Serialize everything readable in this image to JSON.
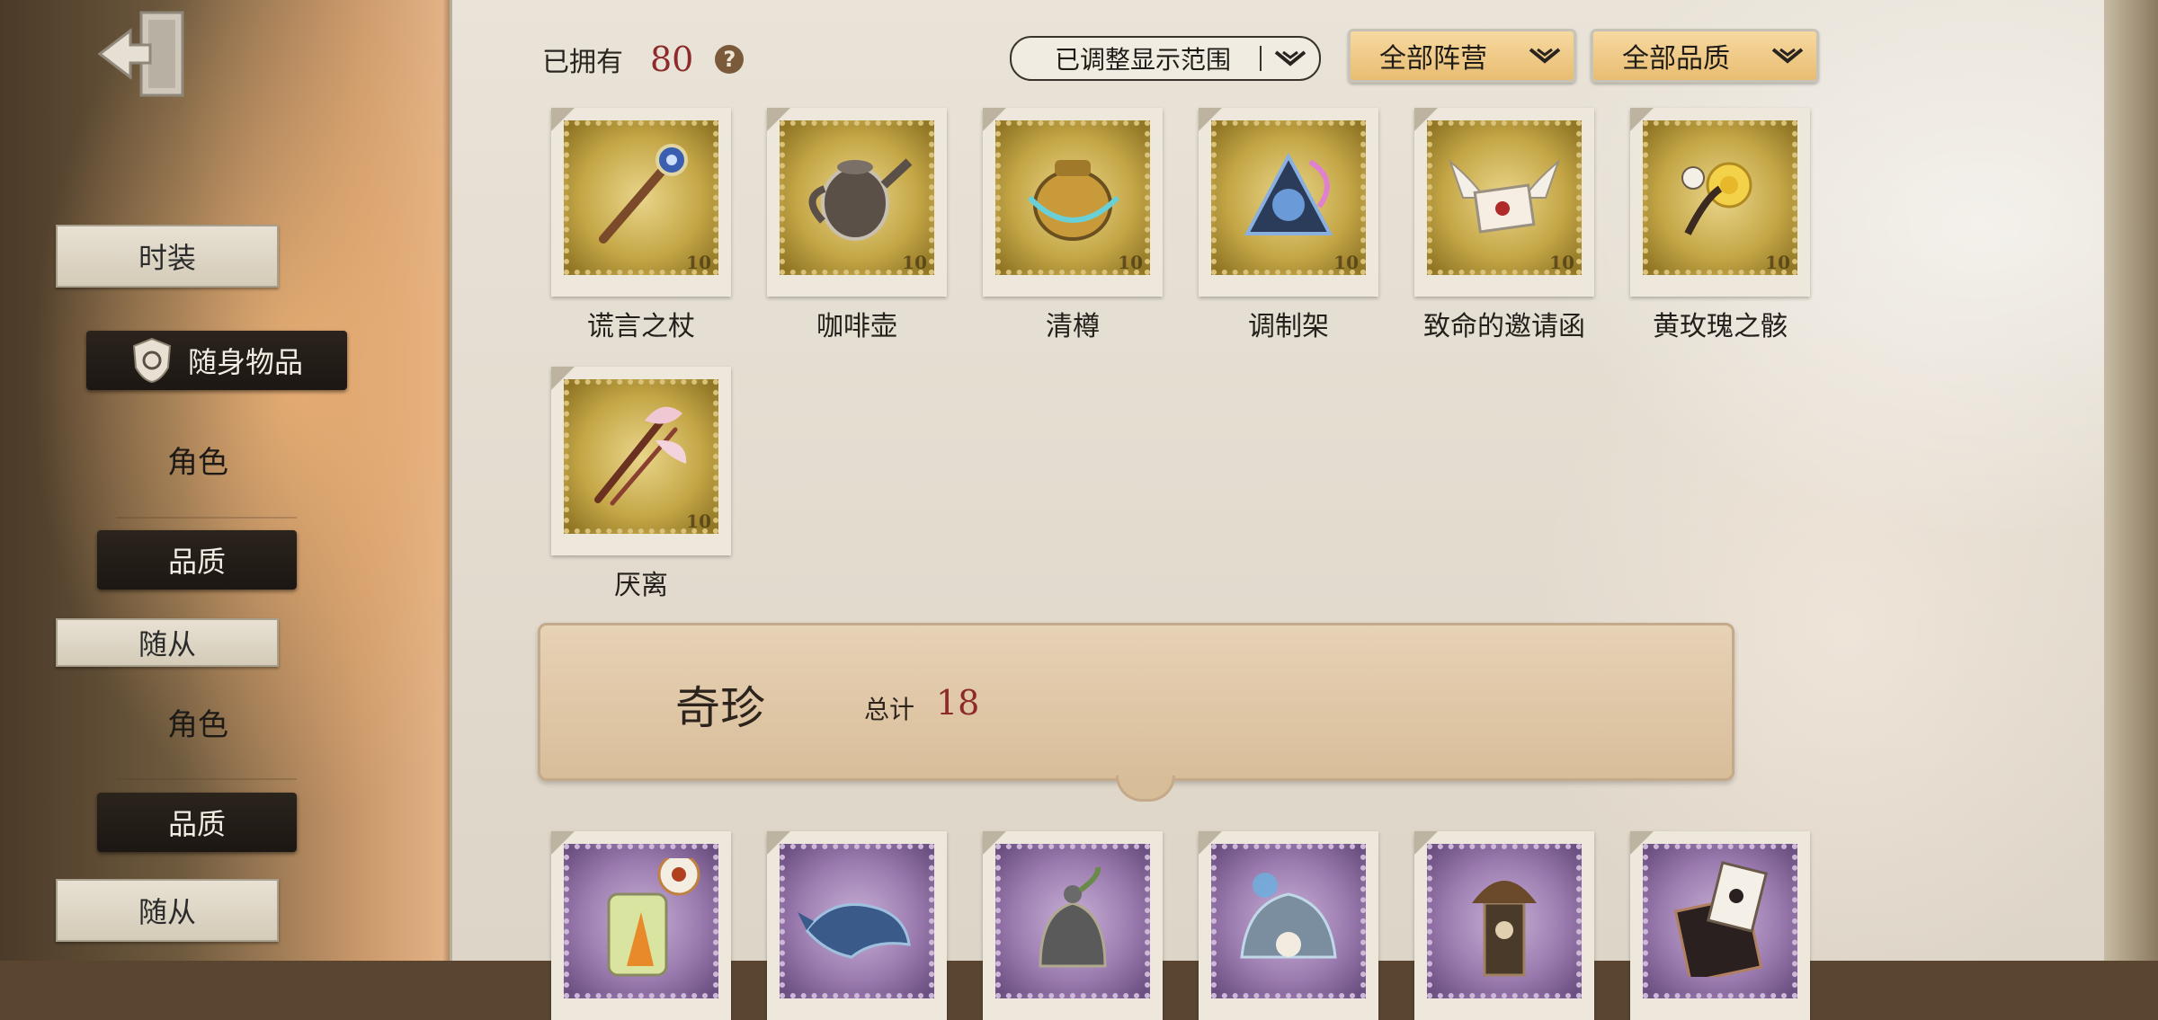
{
  "sidebar": {
    "items": [
      {
        "label": "时装"
      },
      {
        "label": "随身物品"
      },
      {
        "label": "角色"
      },
      {
        "label": "品质"
      },
      {
        "label": "随从"
      },
      {
        "label": "角色"
      },
      {
        "label": "品质"
      },
      {
        "label": "随从"
      }
    ]
  },
  "header": {
    "owned_label": "已拥有",
    "owned_count": "80",
    "help_symbol": "?",
    "range_label": "已调整显示范围",
    "camp_filter": "全部阵营",
    "quality_filter": "全部品质"
  },
  "items_gold": [
    {
      "name": "谎言之杖",
      "icon": "scepter-icon"
    },
    {
      "name": "咖啡壶",
      "icon": "coffee-pot-icon"
    },
    {
      "name": "清樽",
      "icon": "jar-icon"
    },
    {
      "name": "调制架",
      "icon": "crystal-rack-icon"
    },
    {
      "name": "致命的邀请函",
      "icon": "winged-letter-icon"
    },
    {
      "name": "黄玫瑰之骸",
      "icon": "rose-icon"
    },
    {
      "name": "厌离",
      "icon": "blossom-staff-icon"
    }
  ],
  "stamp_value": "10",
  "section": {
    "title": "奇珍",
    "total_label": "总计",
    "total": "18"
  },
  "items_purple": [
    {
      "icon": "carrot-jar-icon"
    },
    {
      "icon": "whale-icon"
    },
    {
      "icon": "bell-icon"
    },
    {
      "icon": "shell-pearl-icon"
    },
    {
      "icon": "tree-figure-icon"
    },
    {
      "icon": "card-book-icon"
    }
  ],
  "colors": {
    "count_red": "#8d2a2a",
    "gold_stamp": "#c4a646",
    "purple_stamp": "#9a7aae",
    "filter_orange": "#e8bd72"
  }
}
